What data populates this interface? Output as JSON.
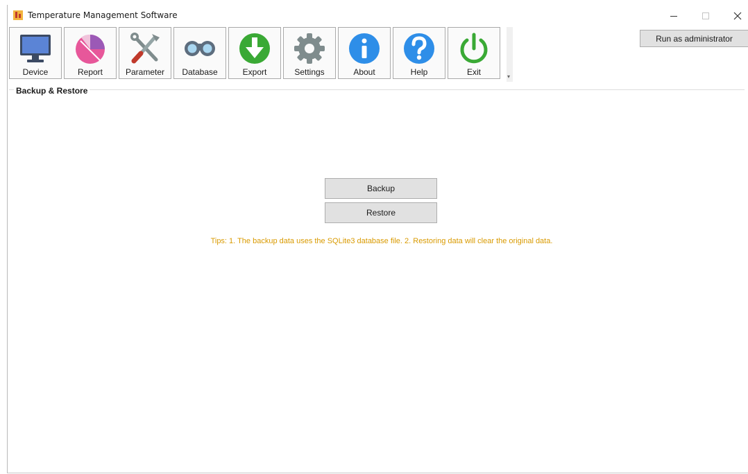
{
  "window": {
    "title": "Temperature Management Software",
    "controls": [
      "minimize-icon",
      "maximize-icon",
      "close-icon"
    ]
  },
  "toolbar": {
    "items": [
      {
        "label": "Device",
        "icon": "monitor-icon"
      },
      {
        "label": "Report",
        "icon": "pie-chart-icon"
      },
      {
        "label": "Parameter",
        "icon": "tools-icon"
      },
      {
        "label": "Database",
        "icon": "binoculars-icon"
      },
      {
        "label": "Export",
        "icon": "export-arrow-icon"
      },
      {
        "label": "Settings",
        "icon": "gear-icon"
      },
      {
        "label": "About",
        "icon": "info-icon"
      },
      {
        "label": "Help",
        "icon": "help-icon"
      },
      {
        "label": "Exit",
        "icon": "power-icon"
      }
    ],
    "admin_button": "Run as administrator"
  },
  "section": {
    "title": "Backup & Restore",
    "backup_button": "Backup",
    "restore_button": "Restore",
    "tips": "Tips: 1. The backup data uses the SQLite3 database file. 2. Restoring data will clear the original data."
  },
  "colors": {
    "tips": "#d99a00",
    "button_face": "#e1e1e1",
    "exit_green": "#3aa935",
    "info_blue": "#2e8ee8"
  }
}
